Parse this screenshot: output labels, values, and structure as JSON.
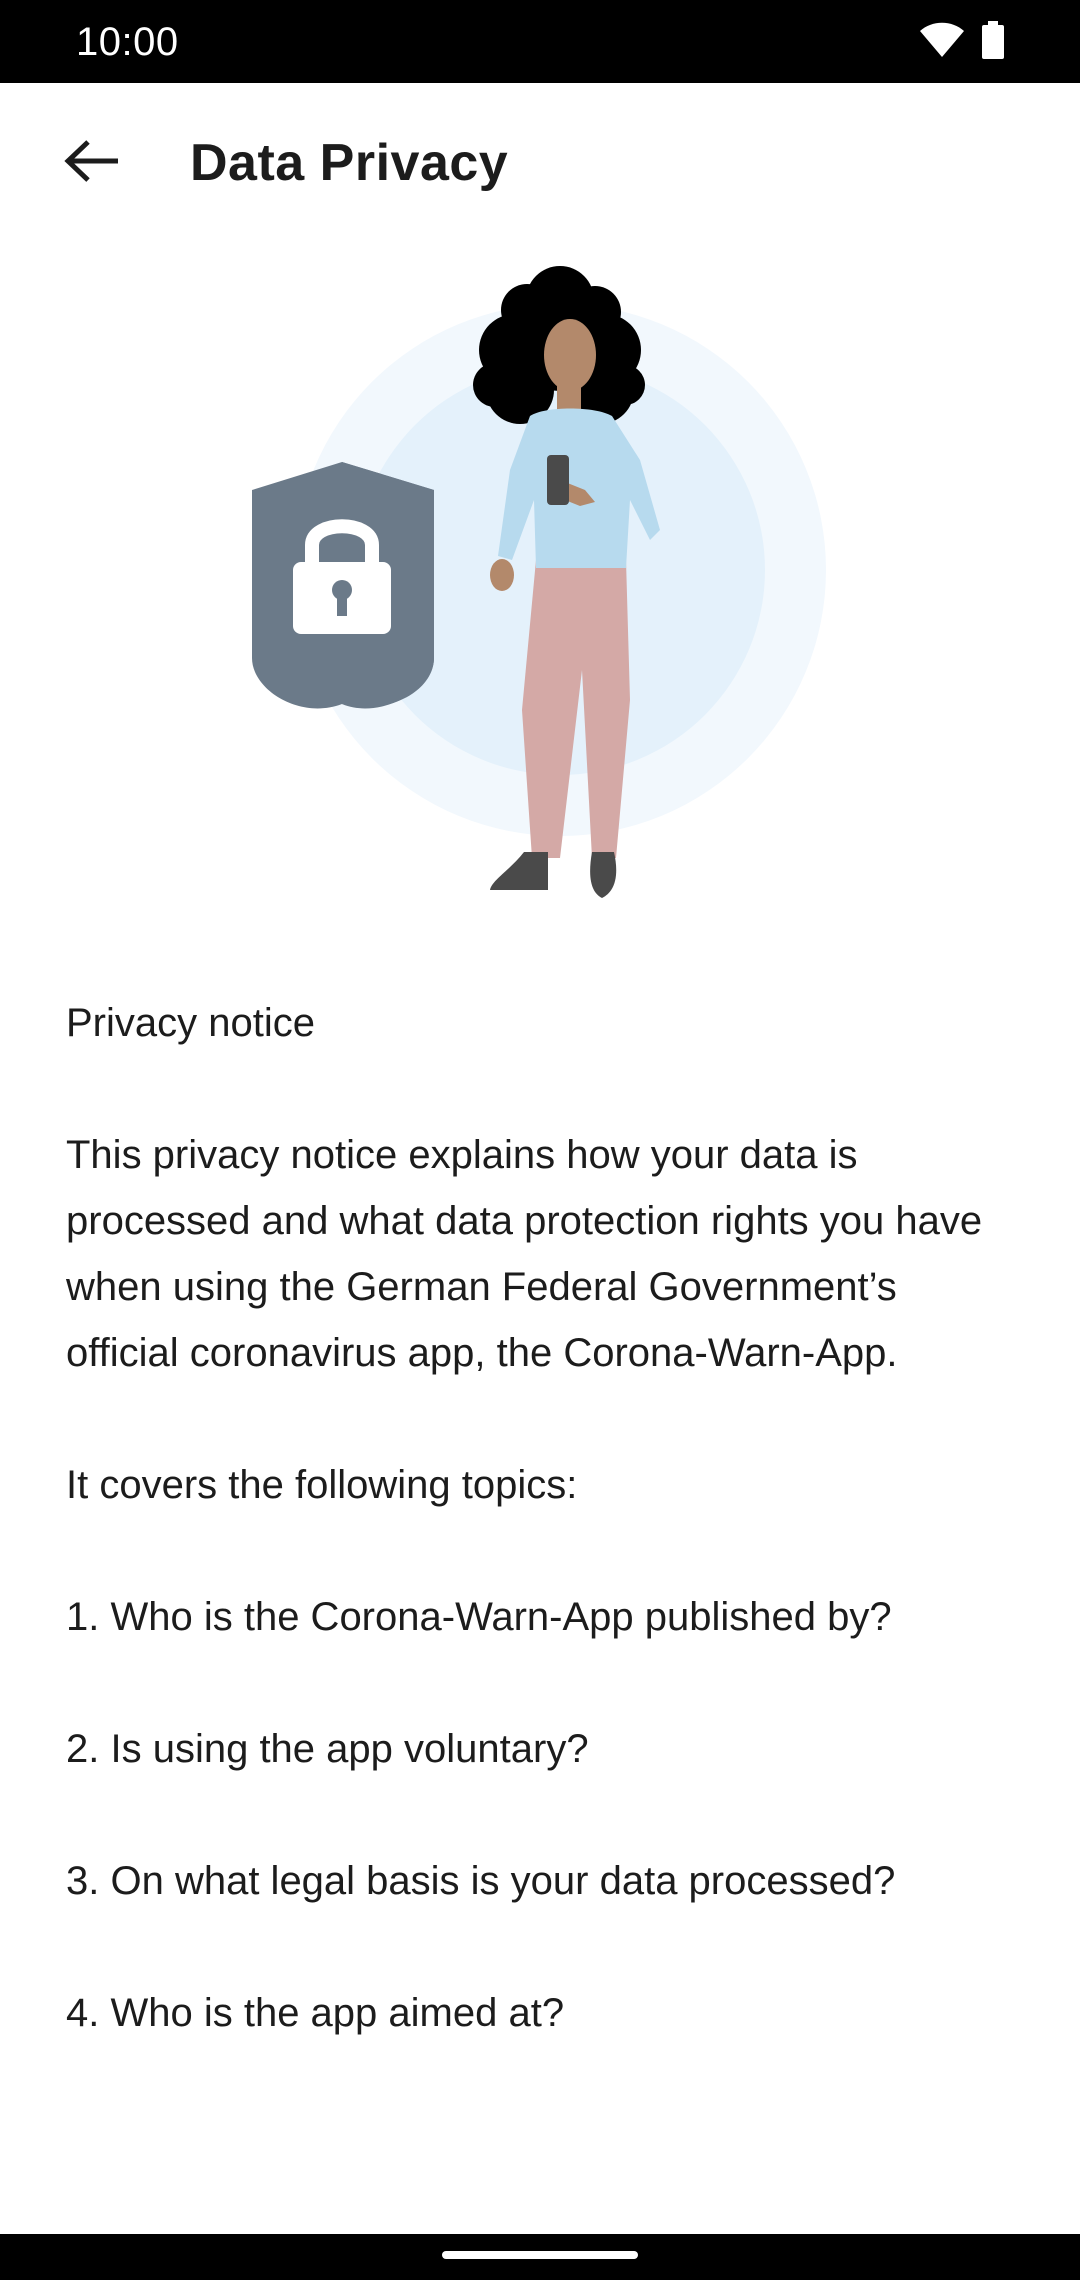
{
  "status_bar": {
    "time": "10:00",
    "icons": [
      "wifi-icon",
      "battery-icon"
    ]
  },
  "app_bar": {
    "back_icon": "arrow-back-icon",
    "title": "Data Privacy"
  },
  "illustration": {
    "name": "privacy-illustration",
    "colors": {
      "outer_circle": "#f2f8fd",
      "inner_circle": "#e4f1fb",
      "shield": "#6b7a89",
      "sweater": "#b7daee",
      "pants": "#d4a9a6",
      "skin": "#b3896b",
      "hair": "#000000"
    }
  },
  "content": {
    "heading": "Privacy notice",
    "intro": "This privacy notice explains how your data is processed and what data protection rights you have when using the German Federal Government’s official coronavirus app, the Corona-Warn-App.",
    "topics_lead": "It covers the following topics:",
    "topics": [
      "1. Who is the Corona-Warn-App published by?",
      "2. Is using the app voluntary?",
      "3. On what legal basis is your data processed?",
      "4. Who is the app aimed at?"
    ]
  }
}
